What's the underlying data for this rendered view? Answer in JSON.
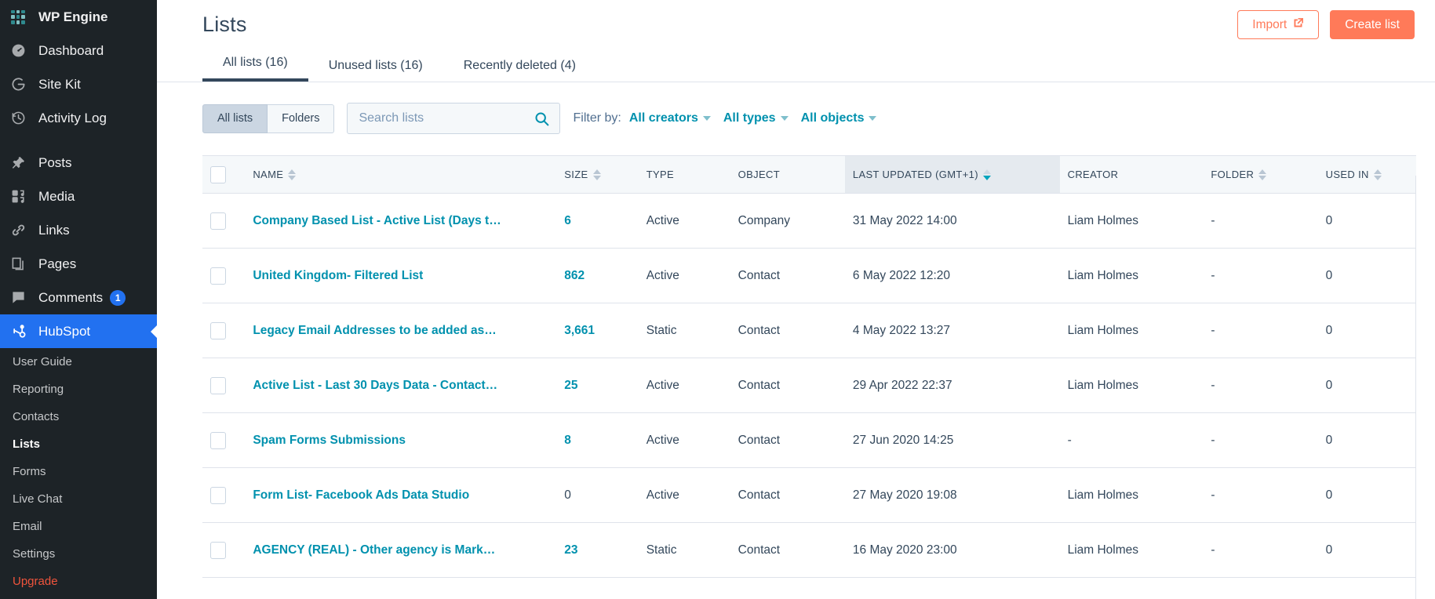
{
  "sidebar": {
    "brand": {
      "label": "WP Engine",
      "icon": "grid-logo-icon"
    },
    "items": [
      {
        "label": "Dashboard",
        "icon": "dashboard-icon"
      },
      {
        "label": "Site Kit",
        "icon": "google-g-icon"
      },
      {
        "label": "Activity Log",
        "icon": "clock-history-icon"
      },
      {
        "label": "Posts",
        "icon": "pin-icon"
      },
      {
        "label": "Media",
        "icon": "media-icon"
      },
      {
        "label": "Links",
        "icon": "link-icon"
      },
      {
        "label": "Pages",
        "icon": "pages-icon"
      },
      {
        "label": "Comments",
        "icon": "comment-icon",
        "badge": "1"
      },
      {
        "label": "HubSpot",
        "icon": "hubspot-sprocket-icon",
        "active": true
      }
    ],
    "sub_items": [
      {
        "label": "User Guide"
      },
      {
        "label": "Reporting"
      },
      {
        "label": "Contacts"
      },
      {
        "label": "Lists",
        "current": true
      },
      {
        "label": "Forms"
      },
      {
        "label": "Live Chat"
      },
      {
        "label": "Email"
      },
      {
        "label": "Settings"
      },
      {
        "label": "Upgrade",
        "style": "upgrade"
      }
    ]
  },
  "header": {
    "title": "Lists",
    "import_label": "Import",
    "import_icon": "external-link-icon",
    "create_label": "Create list"
  },
  "tabs": [
    {
      "label": "All lists (16)",
      "active": true
    },
    {
      "label": "Unused lists (16)",
      "active": false
    },
    {
      "label": "Recently deleted (4)",
      "active": false
    }
  ],
  "toolbar": {
    "segment": [
      {
        "label": "All lists",
        "selected": true
      },
      {
        "label": "Folders",
        "selected": false
      }
    ],
    "search_placeholder": "Search lists",
    "search_value": "",
    "search_icon": "search-icon",
    "filter_by_label": "Filter by:",
    "filters": [
      {
        "label": "All creators"
      },
      {
        "label": "All types"
      },
      {
        "label": "All objects"
      }
    ]
  },
  "table": {
    "columns": [
      {
        "key": "name",
        "label": "NAME",
        "sortable": true,
        "sorted": false
      },
      {
        "key": "size",
        "label": "SIZE",
        "sortable": true,
        "sorted": false
      },
      {
        "key": "type",
        "label": "TYPE",
        "sortable": false,
        "sorted": false
      },
      {
        "key": "object",
        "label": "OBJECT",
        "sortable": false,
        "sorted": false
      },
      {
        "key": "updated",
        "label": "LAST UPDATED (GMT+1)",
        "sortable": true,
        "sorted": true,
        "direction": "desc"
      },
      {
        "key": "creator",
        "label": "CREATOR",
        "sortable": false,
        "sorted": false
      },
      {
        "key": "folder",
        "label": "FOLDER",
        "sortable": true,
        "sorted": false
      },
      {
        "key": "used_in",
        "label": "USED IN",
        "sortable": true,
        "sorted": false
      }
    ],
    "rows": [
      {
        "name": "Company Based List - Active List (Days t…",
        "size": "6",
        "size_link": true,
        "type": "Active",
        "object": "Company",
        "updated": "31 May 2022 14:00",
        "creator": "Liam Holmes",
        "folder": "-",
        "used_in": "0"
      },
      {
        "name": "United Kingdom- Filtered List",
        "size": "862",
        "size_link": true,
        "type": "Active",
        "object": "Contact",
        "updated": "6 May 2022 12:20",
        "creator": "Liam Holmes",
        "folder": "-",
        "used_in": "0"
      },
      {
        "name": "Legacy Email Addresses to be added as…",
        "size": "3,661",
        "size_link": true,
        "type": "Static",
        "object": "Contact",
        "updated": "4 May 2022 13:27",
        "creator": "Liam Holmes",
        "folder": "-",
        "used_in": "0"
      },
      {
        "name": "Active List - Last 30 Days Data - Contact…",
        "size": "25",
        "size_link": true,
        "type": "Active",
        "object": "Contact",
        "updated": "29 Apr 2022 22:37",
        "creator": "Liam Holmes",
        "folder": "-",
        "used_in": "0"
      },
      {
        "name": "Spam Forms Submissions",
        "size": "8",
        "size_link": true,
        "type": "Active",
        "object": "Contact",
        "updated": "27 Jun 2020 14:25",
        "creator": "-",
        "folder": "-",
        "used_in": "0"
      },
      {
        "name": "Form List- Facebook Ads Data Studio",
        "size": "0",
        "size_link": false,
        "type": "Active",
        "object": "Contact",
        "updated": "27 May 2020 19:08",
        "creator": "Liam Holmes",
        "folder": "-",
        "used_in": "0"
      },
      {
        "name": "AGENCY (REAL) - Other agency is Mark…",
        "size": "23",
        "size_link": true,
        "type": "Static",
        "object": "Contact",
        "updated": "16 May 2020 23:00",
        "creator": "Liam Holmes",
        "folder": "-",
        "used_in": "0"
      }
    ]
  },
  "colors": {
    "accent_orange": "#ff7a59",
    "link_teal": "#0091ae",
    "navy": "#33475b",
    "sidebar_bg": "#1d2327",
    "active_blue": "#2271f0",
    "upgrade_red": "#f0543c"
  }
}
